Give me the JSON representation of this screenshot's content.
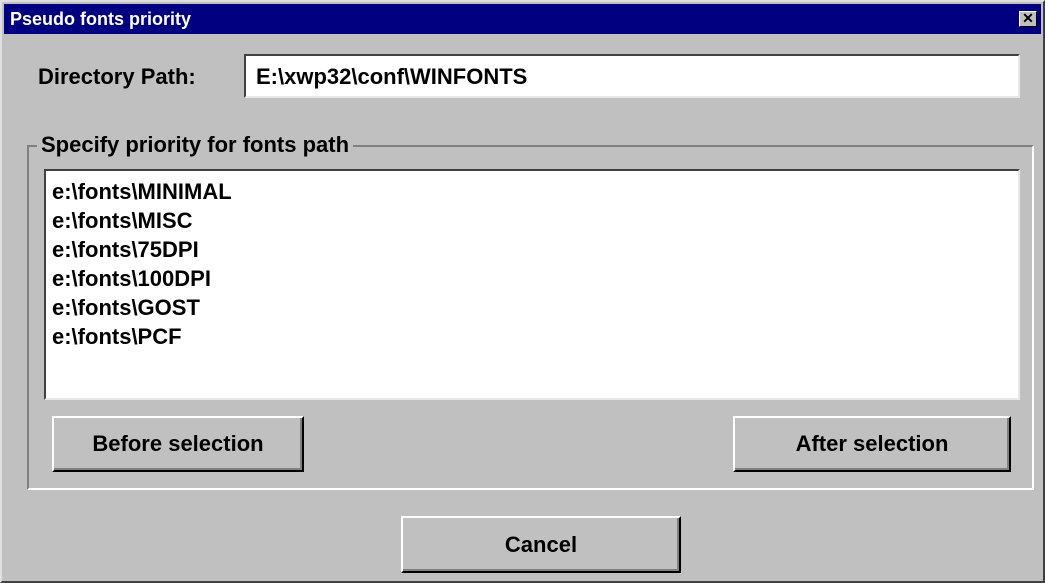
{
  "window": {
    "title": "Pseudo fonts priority",
    "close_glyph": "✕"
  },
  "directory": {
    "label": "Directory Path:",
    "value": "E:\\xwp32\\conf\\WINFONTS"
  },
  "priority_group": {
    "legend": "Specify priority for fonts path",
    "items": [
      "e:\\fonts\\MINIMAL",
      "e:\\fonts\\MISC",
      "e:\\fonts\\75DPI",
      "e:\\fonts\\100DPI",
      "e:\\fonts\\GOST",
      "e:\\fonts\\PCF"
    ],
    "before_label": "Before selection",
    "after_label": "After selection"
  },
  "footer": {
    "cancel_label": "Cancel"
  },
  "colors": {
    "titlebar": "#000080",
    "face": "#c0c0c0",
    "field": "#ffffff"
  }
}
